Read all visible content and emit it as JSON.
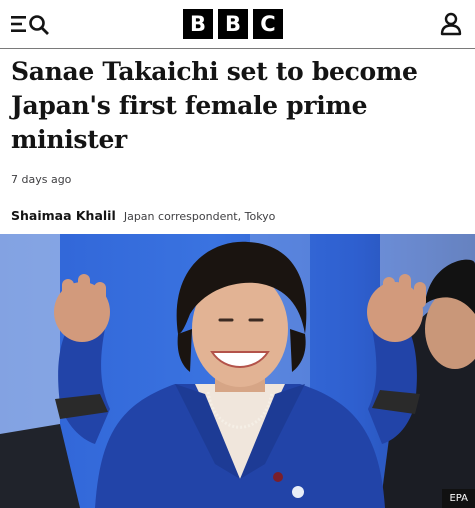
{
  "header": {
    "logo": [
      "B",
      "B",
      "C"
    ],
    "icons": {
      "menu": "menu-icon",
      "search": "search-icon",
      "account": "account-icon"
    }
  },
  "article": {
    "headline": "Sanae Takaichi set to become Japan's first female prime minister",
    "timestamp": "7 days ago",
    "author": "Shaimaa Khalil",
    "role": "Japan correspondent, Tokyo"
  },
  "image": {
    "credit": "EPA"
  },
  "colors": {
    "background": "#ffffff",
    "text": "#141414",
    "muted": "#3f3f42",
    "logo_box": "#000000",
    "photo_blue": "#2a5bd0"
  }
}
